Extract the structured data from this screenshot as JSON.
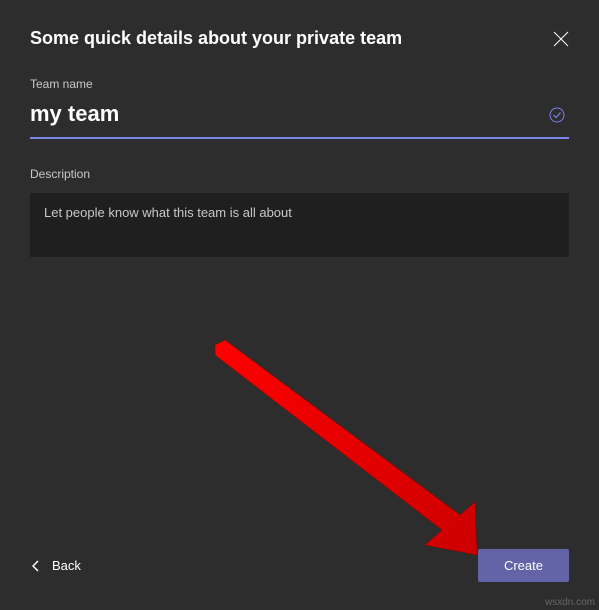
{
  "dialog": {
    "title": "Some quick details about your private team"
  },
  "fields": {
    "teamName": {
      "label": "Team name",
      "value": "my team"
    },
    "description": {
      "label": "Description",
      "placeholder": "Let people know what this team is all about",
      "value": ""
    }
  },
  "buttons": {
    "back": "Back",
    "create": "Create"
  },
  "annotation": {
    "arrowColor": "#ff0000"
  },
  "watermark": "wsxdn.com"
}
